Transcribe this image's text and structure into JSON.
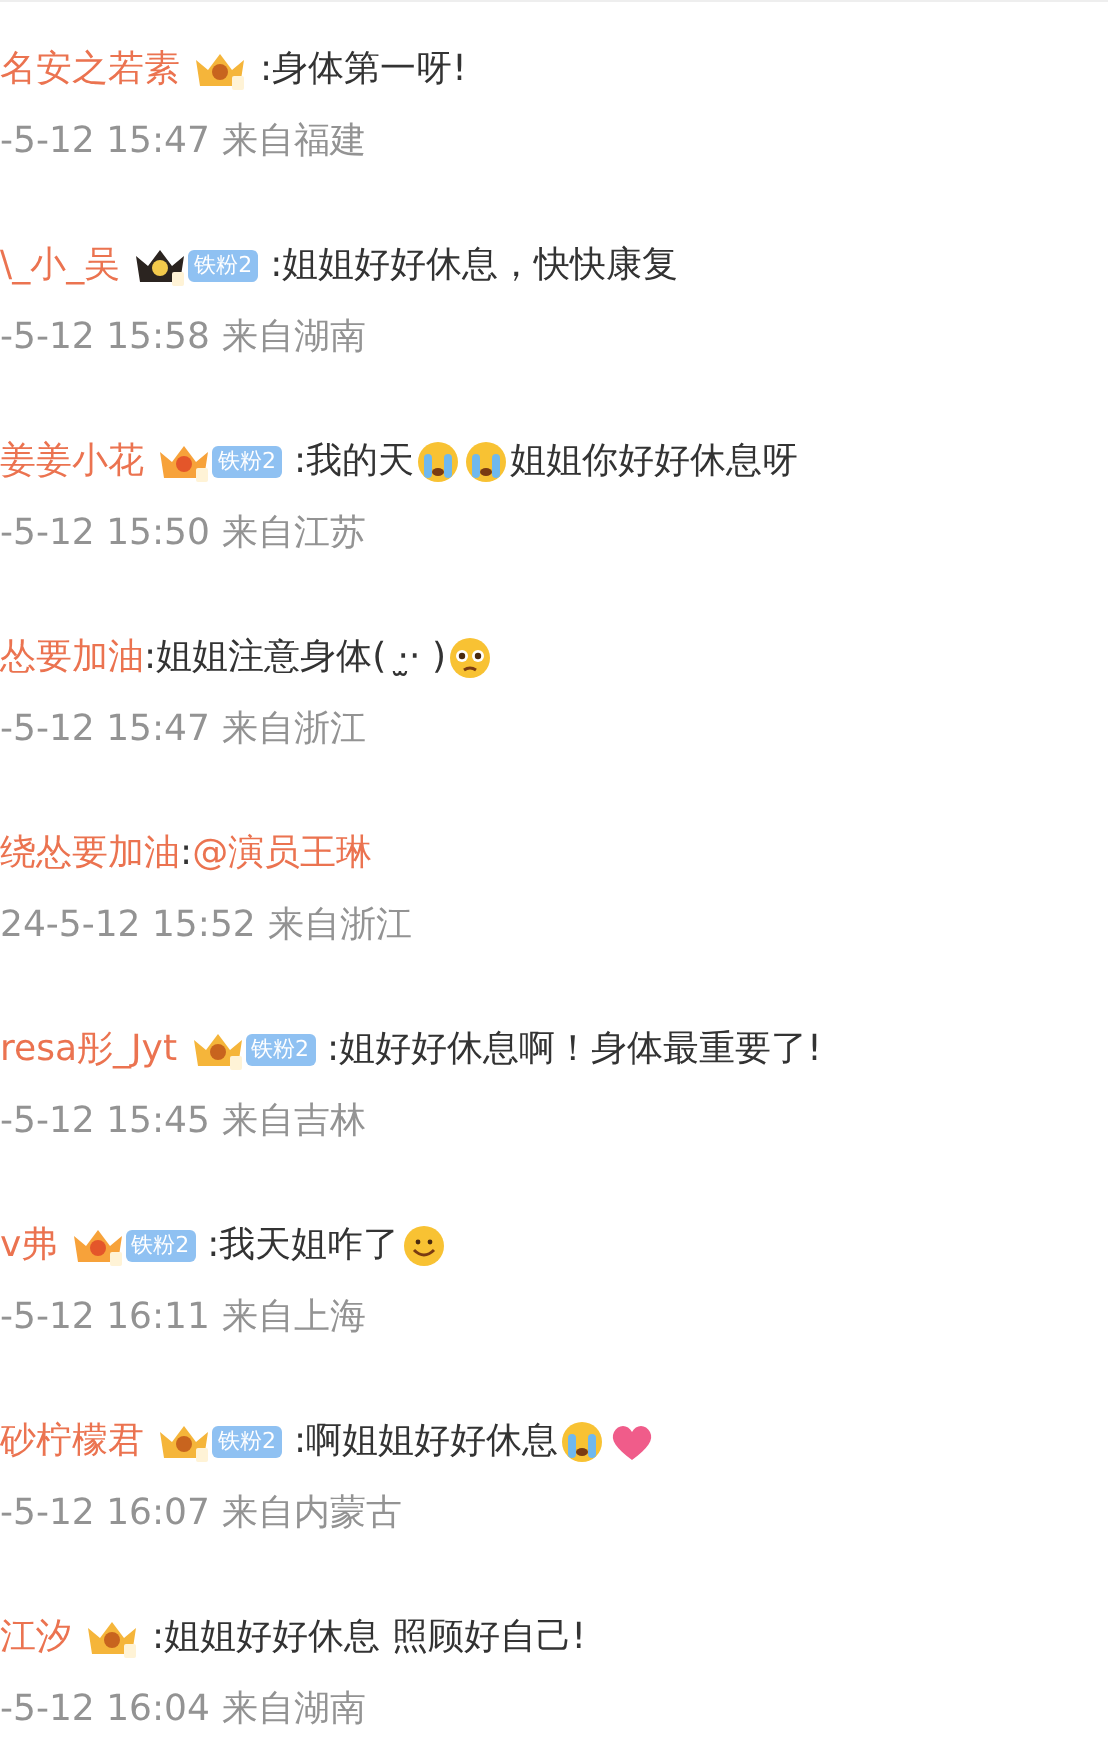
{
  "comments": [
    {
      "name": "名安之若素",
      "crown": {
        "kind": "gold"
      },
      "content": [
        {
          "kind": "text",
          "text": ":身体第一呀!"
        }
      ],
      "time": "-5-12 15:47",
      "location": "来自福建"
    },
    {
      "name": "\\_小_吴",
      "crown": {
        "kind": "dark"
      },
      "fan_badge": "铁粉2",
      "content": [
        {
          "kind": "text",
          "text": ":姐姐好好休息，快快康复"
        }
      ],
      "time": "-5-12 15:58",
      "location": "来自湖南"
    },
    {
      "name": "姜姜小花",
      "crown": {
        "kind": "orange"
      },
      "fan_badge": "铁粉2",
      "content": [
        {
          "kind": "text",
          "text": ":我的天"
        },
        {
          "kind": "cry"
        },
        {
          "kind": "cry"
        },
        {
          "kind": "text",
          "text": " 姐姐你好好休息呀"
        }
      ],
      "time": "-5-12 15:50",
      "location": "来自江苏"
    },
    {
      "name": "怂要加油",
      "content": [
        {
          "kind": "text",
          "text": ":姐姐注意身体( ·̫· )"
        },
        {
          "kind": "pleading"
        }
      ],
      "time": "-5-12 15:47",
      "location": "来自浙江"
    },
    {
      "name": "绕怂要加油",
      "content": [
        {
          "kind": "text",
          "text": ":"
        },
        {
          "kind": "mention",
          "text": "@演员王琳"
        }
      ],
      "time": "24-5-12 15:52",
      "location": "来自浙江"
    },
    {
      "name": "resa彤_Jyt",
      "crown": {
        "kind": "gold"
      },
      "fan_badge": "铁粉2",
      "content": [
        {
          "kind": "text",
          "text": ":姐好好休息啊！身体最重要了!"
        }
      ],
      "time": "-5-12 15:45",
      "location": "来自吉林"
    },
    {
      "name": "v弗",
      "crown": {
        "kind": "orange"
      },
      "fan_badge": "铁粉2",
      "content": [
        {
          "kind": "text",
          "text": ":我天姐咋了"
        },
        {
          "kind": "hug"
        }
      ],
      "time": "-5-12 16:11",
      "location": "来自上海"
    },
    {
      "name": "砂柠檬君",
      "crown": {
        "kind": "gold"
      },
      "fan_badge": "铁粉2",
      "content": [
        {
          "kind": "text",
          "text": ":啊姐姐好好休息"
        },
        {
          "kind": "cry"
        },
        {
          "kind": "heart"
        }
      ],
      "time": "-5-12 16:07",
      "location": "来自内蒙古"
    },
    {
      "name": "江汐",
      "crown": {
        "kind": "gold"
      },
      "content": [
        {
          "kind": "text",
          "text": ":姐姐好好休息 照顾好自己!"
        }
      ],
      "time": "-5-12 16:04",
      "location": "来自湖南"
    }
  ]
}
